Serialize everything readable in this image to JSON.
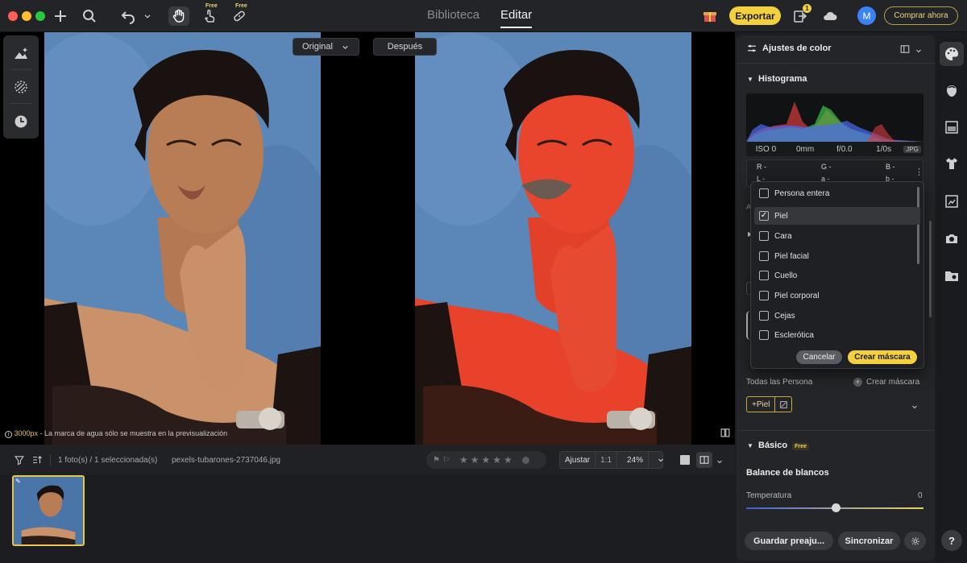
{
  "titlebar": {
    "free_label_1": "Free",
    "free_label_2": "Free",
    "tabs": [
      "Biblioteca",
      "Editar"
    ],
    "active_tab": "Editar",
    "export_label": "Exportar",
    "notification_count": "1",
    "avatar_initial": "M",
    "buy_label": "Comprar ahora"
  },
  "canvas": {
    "compare_original": "Original",
    "compare_after": "Después",
    "watermark_px": "3000px",
    "watermark_text": " - La marca de agua sólo se muestra en la previsualización"
  },
  "filmstrip": {
    "selection_text": "1 foto(s) / 1 seleccionada(s)",
    "filename": "pexels-tubarones-2737046.jpg",
    "adjust_label": "Ajustar",
    "ratio_label": "1:1",
    "zoom_label": "24%"
  },
  "panel": {
    "title": "Ajustes de color",
    "histogram_title": "Histograma",
    "exif": [
      "ISO 0",
      "0mm",
      "f/0.0",
      "1/0s"
    ],
    "format_badge": "JPG",
    "rgb_labels": [
      "R -",
      "G -",
      "B -"
    ],
    "lab_labels": [
      "L -",
      "a -",
      "b -"
    ],
    "all_persons": "Todas las Persona",
    "create_mask_link": "Crear máscara",
    "piel_tag": "+Piel",
    "basic_title": "Básico",
    "basic_free": "Free",
    "white_balance": "Balance de blancos",
    "temperature_label": "Temperatura",
    "temperature_value": "0",
    "save_preset": "Guardar preaju...",
    "sync_label": "Sincronizar",
    "help_label": "?"
  },
  "dropdown": {
    "items": [
      {
        "label": "Persona entera",
        "checked": false
      },
      {
        "label": "Piel",
        "checked": true
      },
      {
        "label": "Cara",
        "checked": false
      },
      {
        "label": "Piel facial",
        "checked": false
      },
      {
        "label": "Cuello",
        "checked": false
      },
      {
        "label": "Piel corporal",
        "checked": false
      },
      {
        "label": "Cejas",
        "checked": false
      },
      {
        "label": "Esclerótica",
        "checked": false
      }
    ],
    "check_mark": "✓",
    "cancel_label": "Cancelar",
    "create_label": "Crear máscara"
  },
  "colors": {
    "accent": "#f4d03f",
    "mask_overlay": "#e8432a",
    "background_blue": "#5a86b8"
  }
}
